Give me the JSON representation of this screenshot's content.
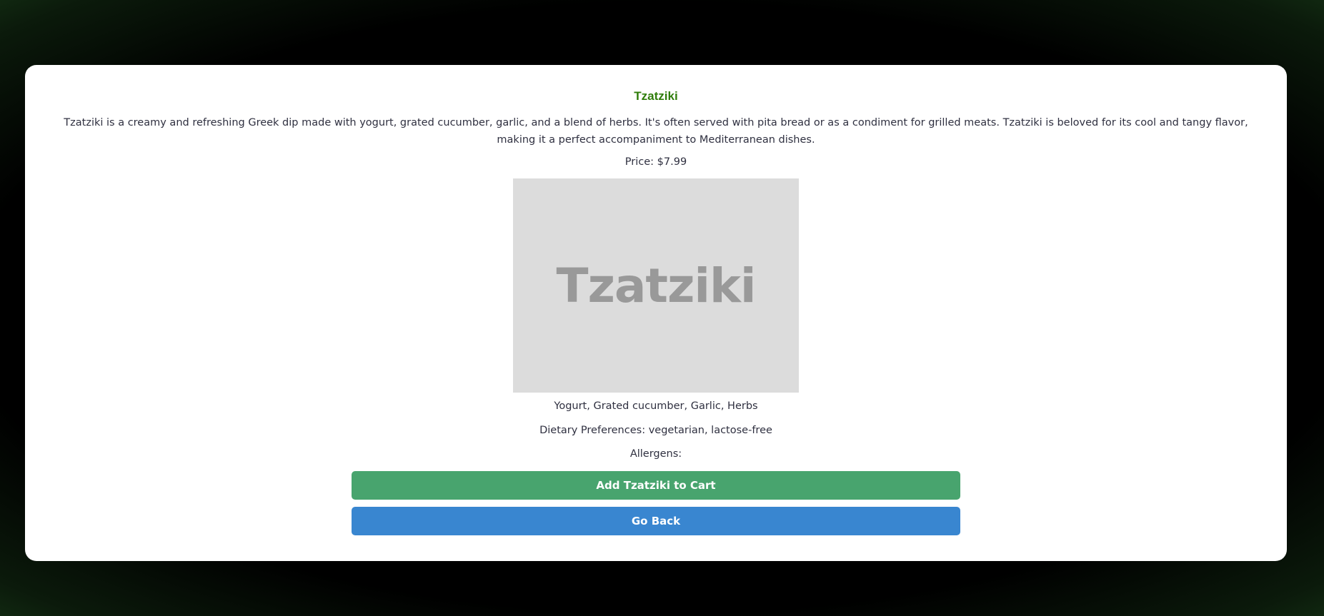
{
  "product": {
    "title": "Tzatziki",
    "description": "Tzatziki is a creamy and refreshing Greek dip made with yogurt, grated cucumber, garlic, and a blend of herbs. It's often served with pita bread or as a condiment for grilled meats. Tzatziki is beloved for its cool and tangy flavor, making it a perfect accompaniment to Mediterranean dishes.",
    "price": "Price: $7.99",
    "image_text": "Tzatziki",
    "ingredients": "Yogurt, Grated cucumber, Garlic, Herbs",
    "dietary": "Dietary Preferences: vegetarian, lactose-free",
    "allergens": "Allergens:"
  },
  "actions": {
    "add_to_cart": "Add Tzatziki to Cart",
    "go_back": "Go Back"
  },
  "colors": {
    "title": "#2f7d0a",
    "cart_button": "#48a46e",
    "back_button": "#3986d0",
    "image_placeholder": "#dcdcdc"
  }
}
